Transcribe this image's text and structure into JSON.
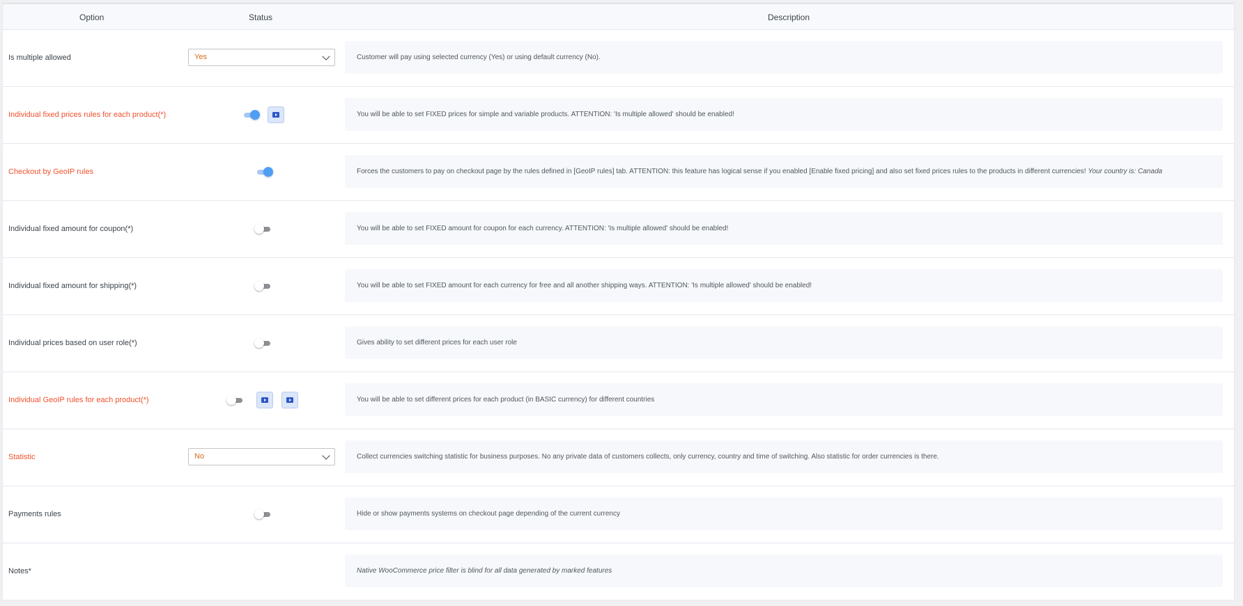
{
  "header": {
    "option": "Option",
    "status": "Status",
    "description": "Description"
  },
  "rows": [
    {
      "option": "Is multiple allowed",
      "control": "select",
      "value": "Yes",
      "description": "Customer will pay using selected currency (Yes) or using default currency (No)."
    },
    {
      "option": "Individual fixed prices rules for each product(*)",
      "control": "toggle",
      "state": "on",
      "icon": "video-tutorial-icon",
      "description": "You will be able to set FIXED prices for simple and variable products. ATTENTION: 'Is multiple allowed' should be enabled!"
    },
    {
      "option": "Checkout by GeoIP rules",
      "control": "toggle",
      "state": "on",
      "description": "Forces the customers to pay on checkout page by the rules defined in [GeoIP rules] tab. ATTENTION: this feature has logical sense if you enabled [Enable fixed pricing] and also set fixed prices rules to the products in different currencies!",
      "description_italic": "Your country is: Canada"
    },
    {
      "option": "Individual fixed amount for coupon(*)",
      "control": "toggle",
      "state": "off",
      "description": "You will be able to set FIXED amount for coupon for each currency. ATTENTION: 'Is multiple allowed' should be enabled!"
    },
    {
      "option": "Individual fixed amount for shipping(*)",
      "control": "toggle",
      "state": "off",
      "description": "You will be able to set FIXED amount for each currency for free and all another shipping ways. ATTENTION: 'Is multiple allowed' should be enabled!"
    },
    {
      "option": "Individual prices based on user role(*)",
      "control": "toggle",
      "state": "off",
      "description": "Gives ability to set different prices for each user role"
    },
    {
      "option": "Individual GeoIP rules for each product(*)",
      "control": "toggle",
      "state": "off",
      "icons": [
        "video-tutorial-icon",
        "video-tutorial-icon"
      ],
      "description": "You will be able to set different prices for each product (in BASIC currency) for different countries"
    },
    {
      "option": "Statistic",
      "control": "select",
      "value": "No",
      "description": "Collect currencies switching statistic for business purposes. No any private data of customers collects, only currency, country and time of switching. Also statistic for order currencies is there."
    },
    {
      "option": "Payments rules",
      "control": "toggle",
      "state": "off",
      "description": "Hide or show payments systems on checkout page depending of the current currency"
    },
    {
      "option": "Notes*",
      "control": "none",
      "description_italic": "Native WooCommerce price filter is blind for all data generated by marked features"
    }
  ],
  "colors": {
    "highlight_label": "#f0512d",
    "select_value": "#d66b1c",
    "toggle_on": "#4f9ef5",
    "toggle_off": "#8c8f94",
    "description_bg": "#f6f8fb"
  }
}
